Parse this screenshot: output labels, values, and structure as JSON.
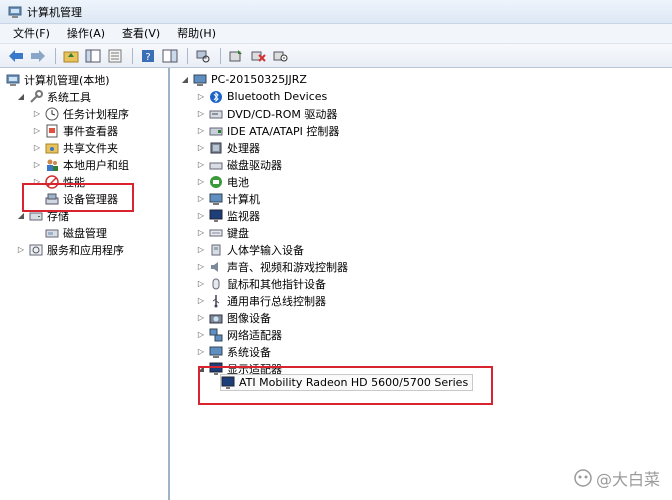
{
  "window": {
    "title": "计算机管理"
  },
  "menu": [
    "文件(F)",
    "操作(A)",
    "查看(V)",
    "帮助(H)"
  ],
  "left_tree": {
    "root": "计算机管理(本地)",
    "system_tools": "系统工具",
    "system_children": [
      "任务计划程序",
      "事件查看器",
      "共享文件夹",
      "本地用户和组",
      "性能",
      "设备管理器"
    ],
    "storage": "存储",
    "storage_children": [
      "磁盘管理"
    ],
    "services": "服务和应用程序"
  },
  "right_tree": {
    "computer": "PC-20150325JJRZ",
    "categories": [
      "Bluetooth Devices",
      "DVD/CD-ROM 驱动器",
      "IDE ATA/ATAPI 控制器",
      "处理器",
      "磁盘驱动器",
      "电池",
      "计算机",
      "监视器",
      "键盘",
      "人体学输入设备",
      "声音、视频和游戏控制器",
      "鼠标和其他指针设备",
      "通用串行总线控制器",
      "图像设备",
      "网络适配器",
      "系统设备",
      "显示适配器"
    ],
    "display_child": "ATI Mobility Radeon HD 5600/5700 Series"
  },
  "watermark": "@大白菜",
  "colors": {
    "highlight": "#d9232e",
    "accent": "#3a78c9"
  }
}
